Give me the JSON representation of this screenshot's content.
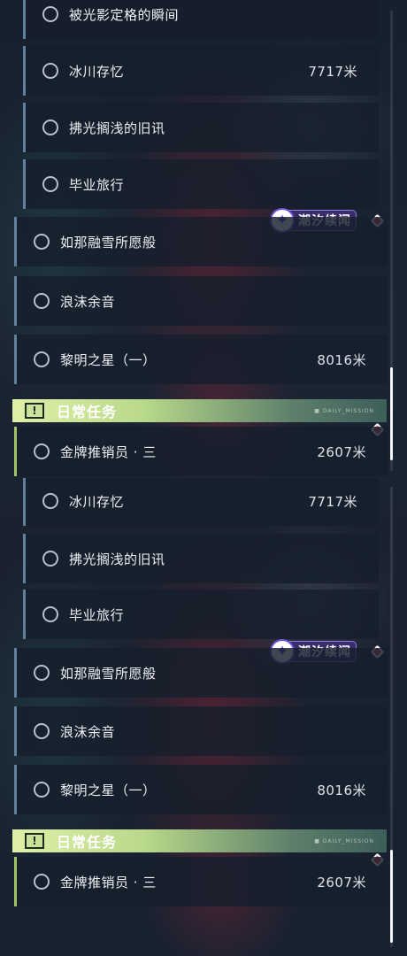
{
  "colors": {
    "marker_red": "#d04a5e",
    "tag_purple": "#3a2d6c",
    "daily_green": "#c9e39a"
  },
  "panel_top": {
    "quests_sub": [
      {
        "label": "被光影定格的瞬间",
        "distance": ""
      },
      {
        "label": "冰川存忆",
        "distance": "7717米"
      },
      {
        "label": "拂光搁浅的旧讯",
        "distance": ""
      },
      {
        "label": "毕业旅行",
        "distance": ""
      }
    ],
    "tag_label": "潮汐续闻",
    "quests_main": [
      {
        "label": "如那融雪所愿般",
        "distance": ""
      },
      {
        "label": "浪沫余音",
        "distance": ""
      },
      {
        "label": "黎明之星（一）",
        "distance": "8016米"
      }
    ],
    "daily_title": "日常任务",
    "daily_deco": "■ DAILY_MISSION",
    "daily_quests": [
      {
        "label": "金牌推销员 · 三",
        "distance": "2607米"
      }
    ]
  },
  "panel_bottom": {
    "quests_sub": [
      {
        "label": "冰川存忆",
        "distance": "7717米"
      },
      {
        "label": "拂光搁浅的旧讯",
        "distance": ""
      },
      {
        "label": "毕业旅行",
        "distance": ""
      }
    ],
    "tag_label": "潮汐续闻",
    "quests_main": [
      {
        "label": "如那融雪所愿般",
        "distance": ""
      },
      {
        "label": "浪沫余音",
        "distance": ""
      },
      {
        "label": "黎明之星（一）",
        "distance": "8016米"
      }
    ],
    "daily_title": "日常任务",
    "daily_deco": "■ DAILY_MISSION",
    "daily_quests": [
      {
        "label": "金牌推销员 · 三",
        "distance": "2607米"
      }
    ]
  }
}
